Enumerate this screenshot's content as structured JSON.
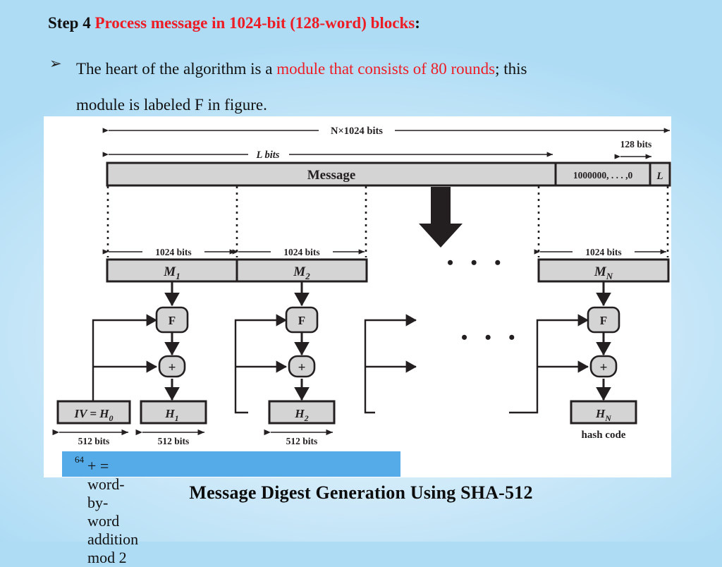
{
  "slide": {
    "step_label": "Step 4",
    "step_title": "Process message in 1024-bit (128-word) blocks",
    "step_colon": ":",
    "bullet_glyph": "➢",
    "para_part1": "The heart of the algorithm is a ",
    "para_highlight": "module that consists of 80 rounds",
    "para_part2": "; this",
    "para_line2_part1": "module is labeled ",
    "para_line2_F": "F",
    "para_line2_part2": " in figure.",
    "figure_caption": "Message Digest Generation Using SHA-512",
    "note_bar": {
      "text": "+ = word-by-word addition mod 2",
      "superscript": "64"
    }
  },
  "figure": {
    "top_dims": {
      "total": "N×1024 bits",
      "message_len": "L bits",
      "tail": "128 bits"
    },
    "message_bar": {
      "message_label": "Message",
      "padding_label": "1000000, . . . ,0",
      "length_label": "L"
    },
    "block_dims": [
      "1024  bits",
      "1024  bits",
      "1024  bits"
    ],
    "blocks": [
      {
        "label": "M",
        "sub": "1"
      },
      {
        "label": "M",
        "sub": "2"
      },
      {
        "label": "M",
        "sub": "N"
      }
    ],
    "round_label": "F",
    "adder_label": "+",
    "chain_values": [
      {
        "label": "IV = H",
        "sub": "0"
      },
      {
        "label": "H",
        "sub": "1"
      },
      {
        "label": "H",
        "sub": "2"
      },
      {
        "label": "H",
        "sub": "N"
      }
    ],
    "hash_code_label": "hash code",
    "chain_dims": [
      "512  bits",
      "512  bits",
      "512  bits"
    ],
    "ellipsis": "•   •   •",
    "colors": {
      "box_fill": "#d4d4d4",
      "stroke": "#231f20",
      "panel": "#ffffff",
      "accent_red": "#ed1b24",
      "caption_bar": "#54abe8"
    }
  }
}
